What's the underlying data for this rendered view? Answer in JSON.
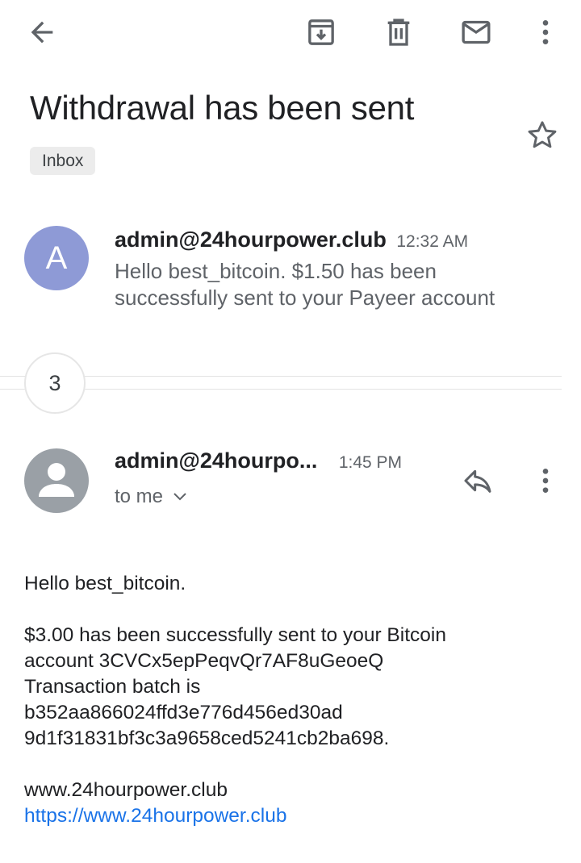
{
  "toolbar": {
    "back_icon": "arrow-left-icon",
    "archive_icon": "archive-icon",
    "delete_icon": "trash-icon",
    "unread_icon": "mail-icon",
    "more_icon": "more-vert-icon"
  },
  "email": {
    "subject": "Withdrawal has been sent",
    "label": "Inbox",
    "starred": false
  },
  "thread": {
    "first_message": {
      "avatar_letter": "A",
      "avatar_color": "#8e9ad6",
      "sender": "admin@24hourpower.club",
      "time": "12:32 AM",
      "snippet": "Hello best_bitcoin. $1.50 has been successfully sent to your Payeer account"
    },
    "collapsed_count": "3",
    "last_message": {
      "sender": "admin@24hourpo...",
      "time": "1:45 PM",
      "recipient": "to me",
      "body": {
        "greeting": "Hello best_bitcoin.",
        "line1": "$3.00 has been successfully sent to your Bitcoin",
        "line2": "account 3CVCx5epPeqvQr7AF8uGeoeQ",
        "line3": "Transaction batch is",
        "line4": "b352aa866024ffd3e776d456ed30ad",
        "line5": "9d1f31831bf3c3a9658ced5241cb2ba698.",
        "site_text": "www.24hourpower.club",
        "site_link": "https://www.24hourpower.club"
      }
    }
  },
  "colors": {
    "link": "#1a73e8",
    "secondary_text": "#5f6368",
    "chip_bg": "#ececec"
  }
}
